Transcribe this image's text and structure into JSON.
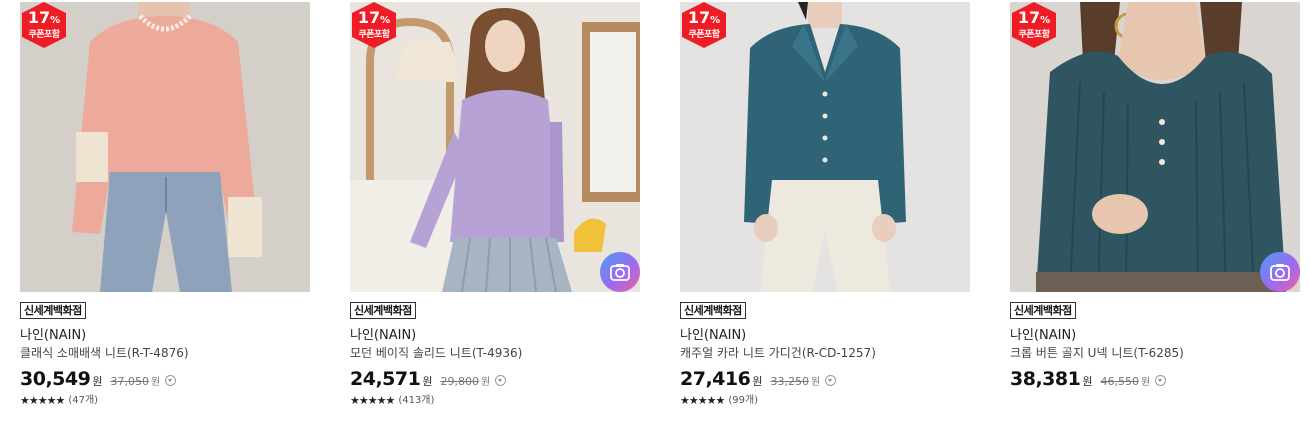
{
  "products": [
    {
      "sale_percent": "17",
      "sale_unit": "%",
      "coupon_label": "쿠폰포함",
      "store": "신세계백화점",
      "brand": "나인(NAIN)",
      "name": "클래식 소매배색 니트(R-T-4876)",
      "price": "30,549",
      "currency": "원",
      "original_price": "37,050",
      "stars": "★★★★★",
      "reviews": "(47개)",
      "has_photo_review": false,
      "colors": {
        "bg": "#d8d3cd",
        "top": "#eda99a",
        "bottom": "#8ea3bb"
      }
    },
    {
      "sale_percent": "17",
      "sale_unit": "%",
      "coupon_label": "쿠폰포함",
      "store": "신세계백화점",
      "brand": "나인(NAIN)",
      "name": "모던 베이직 솔리드 니트(T-4936)",
      "price": "24,571",
      "currency": "원",
      "original_price": "29,800",
      "stars": "★★★★★",
      "reviews": "(413개)",
      "has_photo_review": true,
      "colors": {
        "bg": "#e9e4dd",
        "top": "#b7a2d6",
        "bottom": "#a7b4c2"
      }
    },
    {
      "sale_percent": "17",
      "sale_unit": "%",
      "coupon_label": "쿠폰포함",
      "store": "신세계백화점",
      "brand": "나인(NAIN)",
      "name": "캐주얼 카라 니트 가디건(R-CD-1257)",
      "price": "27,416",
      "currency": "원",
      "original_price": "33,250",
      "stars": "★★★★★",
      "reviews": "(99개)",
      "has_photo_review": false,
      "colors": {
        "bg": "#e4e3e1",
        "top": "#2f6477",
        "bottom": "#eee9de"
      }
    },
    {
      "sale_percent": "17",
      "sale_unit": "%",
      "coupon_label": "쿠폰포함",
      "store": "신세계백화점",
      "brand": "나인(NAIN)",
      "name": "크롭 버튼 골지 U넥 니트(T-6285)",
      "price": "38,381",
      "currency": "원",
      "original_price": "46,550",
      "stars": "★★★★★",
      "reviews": "",
      "has_photo_review": true,
      "colors": {
        "bg": "#d9d6d2",
        "top": "#2e5560",
        "bottom": "#6e5f55"
      }
    }
  ]
}
